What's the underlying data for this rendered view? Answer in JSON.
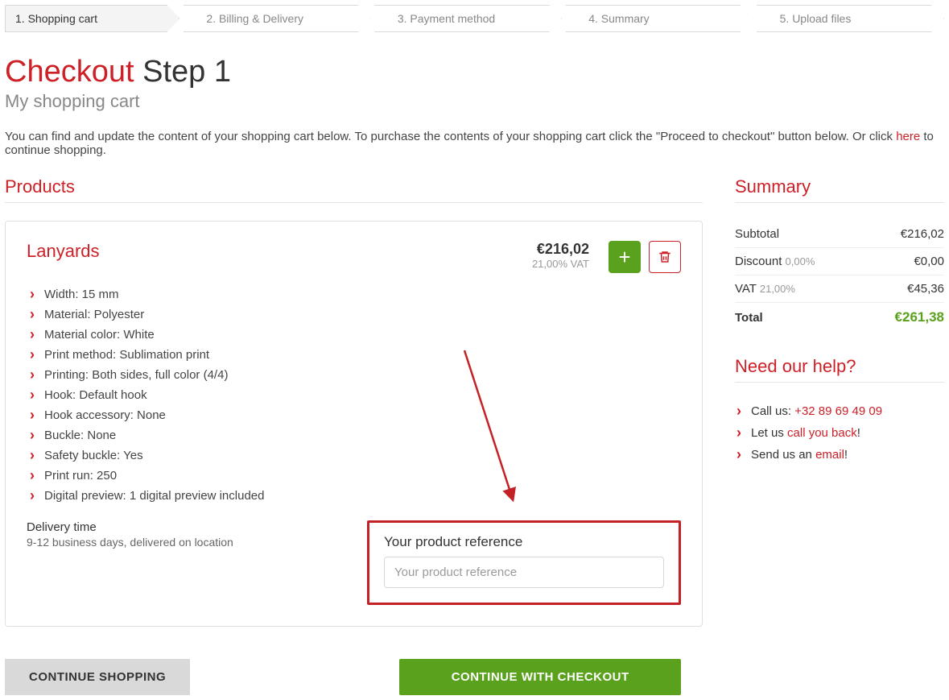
{
  "steps": {
    "s0": "1. Shopping cart",
    "s1": "2. Billing & Delivery",
    "s2": "3. Payment method",
    "s3": "4. Summary",
    "s4": "5. Upload files"
  },
  "heading": {
    "accent": "Checkout",
    "rest": " Step 1"
  },
  "subtitle": "My shopping cart",
  "intro": {
    "text_before": "You can find and update the content of your shopping cart below. To purchase the contents of your shopping cart click the \"Proceed to checkout\" button below. Or click ",
    "link": "here",
    "text_after": " to continue shopping."
  },
  "sections": {
    "products": "Products",
    "summary": "Summary",
    "help": "Need our help?"
  },
  "product": {
    "name": "Lanyards",
    "price": "€216,02",
    "vat_note": "21,00% VAT",
    "specs": {
      "i0": "Width: 15 mm",
      "i1": "Material: Polyester",
      "i2": "Material color: White",
      "i3": "Print method: Sublimation print",
      "i4": "Printing: Both sides, full color (4/4)",
      "i5": "Hook: Default hook",
      "i6": "Hook accessory: None",
      "i7": "Buckle: None",
      "i8": "Safety buckle: Yes",
      "i9": "Print run: 250",
      "i10": "Digital preview: 1 digital preview included"
    },
    "delivery": {
      "label": "Delivery time",
      "value": "9-12 business days, delivered on location"
    },
    "reference": {
      "label": "Your product reference",
      "placeholder": "Your product reference"
    }
  },
  "summary": {
    "subtotal_label": "Subtotal",
    "subtotal_value": "€216,02",
    "discount_label": "Discount",
    "discount_note": "0,00%",
    "discount_value": "€0,00",
    "vat_label": "VAT",
    "vat_note": "21,00%",
    "vat_value": "€45,36",
    "total_label": "Total",
    "total_value": "€261,38"
  },
  "help": {
    "call_prefix": "Call us: ",
    "call_number": "+32 89 69 49 09",
    "callback_prefix": "Let us ",
    "callback_link": "call you back",
    "callback_suffix": "!",
    "email_prefix": "Send us an ",
    "email_link": "email",
    "email_suffix": "!"
  },
  "buttons": {
    "continue_shopping": "CONTINUE SHOPPING",
    "continue_checkout": "CONTINUE WITH CHECKOUT"
  }
}
